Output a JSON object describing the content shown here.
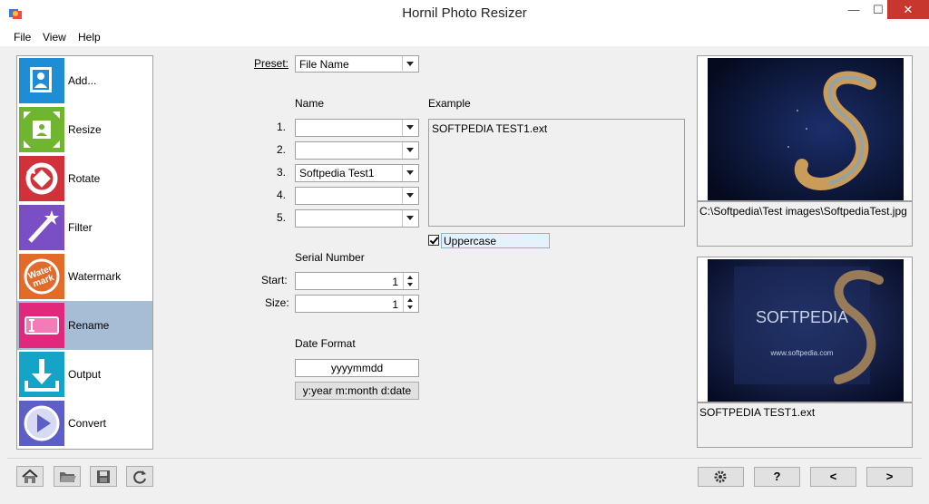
{
  "window": {
    "title": "Hornil Photo Resizer",
    "min": "—",
    "max": "☐",
    "close": "✕"
  },
  "menu": [
    {
      "label": "File"
    },
    {
      "label": "View"
    },
    {
      "label": "Help"
    }
  ],
  "sidebar": {
    "items": [
      {
        "label": "Add...",
        "icon": "add-photo-icon",
        "color": "#1f8dd6"
      },
      {
        "label": "Resize",
        "icon": "resize-icon",
        "color": "#6fb52f"
      },
      {
        "label": "Rotate",
        "icon": "rotate-icon",
        "color": "#d1323a"
      },
      {
        "label": "Filter",
        "icon": "filter-wand-icon",
        "color": "#7a4ec4"
      },
      {
        "label": "Watermark",
        "icon": "watermark-icon",
        "color": "#e36b2a"
      },
      {
        "label": "Rename",
        "icon": "rename-icon",
        "color": "#e0287d",
        "selected": true
      },
      {
        "label": "Output",
        "icon": "output-icon",
        "color": "#14a4c8"
      },
      {
        "label": "Convert",
        "icon": "convert-icon",
        "color": "#5b5fc7"
      }
    ]
  },
  "form": {
    "preset_label": "Preset:",
    "preset_value": "File Name",
    "name_header": "Name",
    "example_header": "Example",
    "rows": [
      {
        "num": "1.",
        "value": ""
      },
      {
        "num": "2.",
        "value": ""
      },
      {
        "num": "3.",
        "value": "Softpedia Test1"
      },
      {
        "num": "4.",
        "value": ""
      },
      {
        "num": "5.",
        "value": ""
      }
    ],
    "example_text": "SOFTPEDIA TEST1.ext",
    "uppercase_label": "Uppercase",
    "uppercase_checked": true,
    "serial_header": "Serial Number",
    "start_label": "Start:",
    "start_value": "1",
    "size_label": "Size:",
    "size_value": "1",
    "date_header": "Date Format",
    "date_value": "yyyymmdd",
    "date_help": "y:year m:month d:date"
  },
  "preview": {
    "top_caption": "C:\\Softpedia\\Test images\\SoftpediaTest.jpg",
    "bottom_caption": "SOFTPEDIA TEST1.ext",
    "bottom_image_text": "SOFTPEDIA",
    "bottom_image_url": "www.softpedia.com"
  },
  "toolbar": {
    "home": "home-icon",
    "open": "folder-open-icon",
    "save": "save-icon",
    "refresh": "refresh-icon",
    "settings": "gear-icon",
    "help_label": "?",
    "prev_label": "<",
    "next_label": ">"
  }
}
